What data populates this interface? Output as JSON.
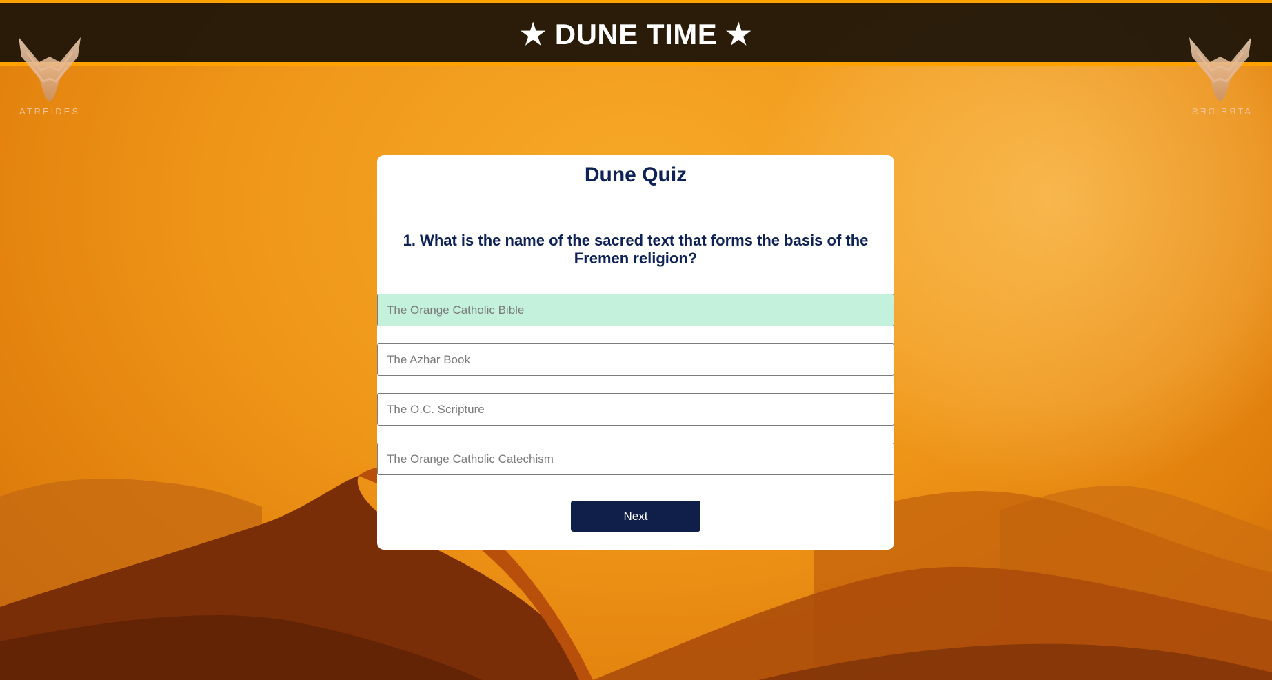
{
  "header": {
    "title": "★ DUNE TIME ★"
  },
  "emblems": {
    "left_text": "ATREIDES",
    "right_text": "ATREIDES"
  },
  "quiz": {
    "title": "Dune Quiz",
    "question": "1. What is the name of the sacred text that forms the basis of the Fremen religion?",
    "options": [
      {
        "label": "The Orange Catholic Bible",
        "selected": true
      },
      {
        "label": "The Azhar Book",
        "selected": false
      },
      {
        "label": "The O.C. Scripture",
        "selected": false
      },
      {
        "label": "The Orange Catholic Catechism",
        "selected": false
      }
    ],
    "next_label": "Next"
  },
  "colors": {
    "header_border": "#ffa200",
    "header_bg": "#1e1408",
    "title_text": "#0f2257",
    "selected_option_bg": "#c4f1dc",
    "button_bg": "#0f1f4a"
  }
}
